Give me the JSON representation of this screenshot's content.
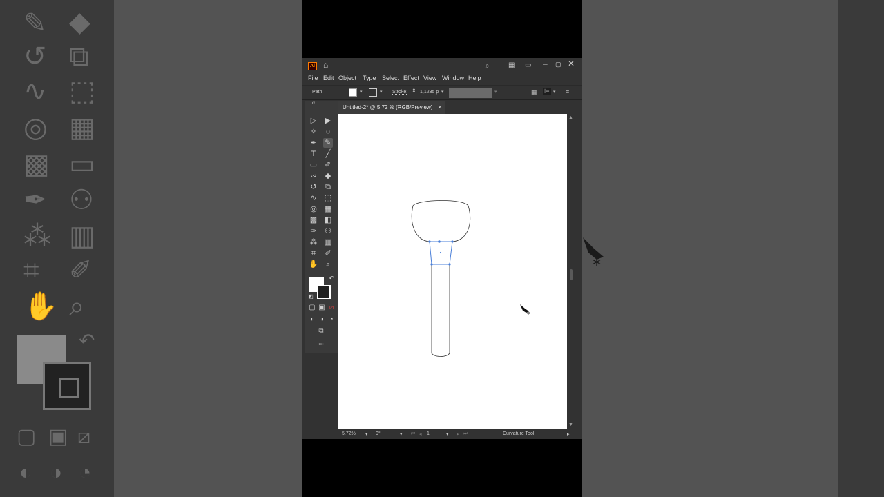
{
  "window": {
    "app_logo": "Ai",
    "menu": [
      "File",
      "Edit",
      "Object",
      "Type",
      "Select",
      "Effect",
      "View",
      "Window",
      "Help"
    ]
  },
  "control_bar": {
    "selection_label": "Path",
    "stroke_label": "Stroke:",
    "stroke_value": "1,1235 p"
  },
  "document": {
    "tab_title": "Untitled-2* @ 5,72 % (RGB/Preview)",
    "close_glyph": "×"
  },
  "status_bar": {
    "zoom": "5.72%",
    "rotation": "0°",
    "artboard_number": "1",
    "active_tool": "Curvature Tool"
  },
  "toolbar": {
    "more_glyph": "•••",
    "tools": [
      "selection",
      "direct-selection",
      "magic-wand",
      "lasso",
      "pen",
      "curvature",
      "type",
      "line",
      "rectangle",
      "paintbrush",
      "shaper",
      "eraser",
      "rotate",
      "scale",
      "warp",
      "free-transform",
      "shape-builder",
      "perspective-grid",
      "mesh",
      "gradient",
      "eyedropper",
      "blend",
      "symbol-sprayer",
      "column-graph",
      "artboard",
      "slice",
      "hand",
      "zoom"
    ],
    "active_tool": "curvature"
  },
  "colors": {
    "fill": "#ffffff",
    "stroke": "#1e1e1e",
    "selection": "#4a7fd8",
    "ui_dark": "#323232"
  }
}
